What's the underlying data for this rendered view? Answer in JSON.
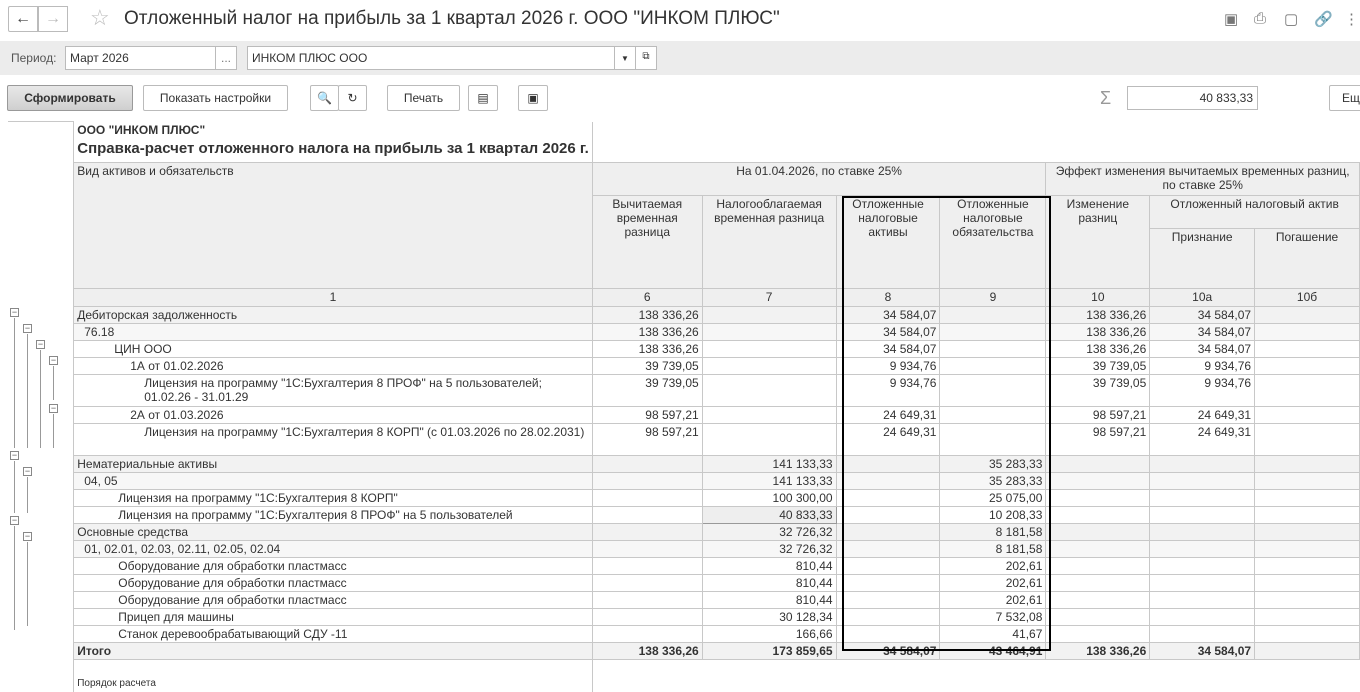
{
  "window": {
    "title": "Отложенный налог на прибыль за 1 квартал 2026 г. ООО \"ИНКОМ ПЛЮС\""
  },
  "filters": {
    "period_label": "Период:",
    "period_value": "Март 2026",
    "period_button": "...",
    "org_value": "ИНКОМ ПЛЮС ООО"
  },
  "toolbar": {
    "generate": "Сформировать",
    "show_settings": "Показать настройки",
    "print": "Печать",
    "sum_value": "40 833,33",
    "more": "Ещ"
  },
  "report": {
    "org": "ООО \"ИНКОМ ПЛЮС\"",
    "title": "Справка-расчет отложенного налога на прибыль за 1 квартал 2026 г.",
    "headers": {
      "col1": "Вид активов и обязательств",
      "group1": "На 01.04.2026, по ставке 25%",
      "group2": "Эффект изменения вычитаемых временных разниц, по ставке 25%",
      "c6": "Вычитаемая временная разница",
      "c7": "Налогооблагаемая временная разница",
      "c8": "Отложенные налоговые активы",
      "c9": "Отложенные налоговые обязательства",
      "c10": "Изменение разниц",
      "c10grp": "Отложенный налоговый актив",
      "c10a": "Признание",
      "c10b": "Погашение"
    },
    "numbers": [
      "1",
      "6",
      "7",
      "8",
      "9",
      "10",
      "10а",
      "10б"
    ],
    "rows": [
      {
        "name": "Дебиторская задолженность",
        "v": [
          "138 336,26",
          "",
          "34 584,07",
          "",
          "138 336,26",
          "34 584,07",
          ""
        ]
      },
      {
        "name": "76.18",
        "v": [
          "138 336,26",
          "",
          "34 584,07",
          "",
          "138 336,26",
          "34 584,07",
          ""
        ]
      },
      {
        "name": "ЦИН ООО",
        "v": [
          "138 336,26",
          "",
          "34 584,07",
          "",
          "138 336,26",
          "34 584,07",
          ""
        ]
      },
      {
        "name": "1А от 01.02.2026",
        "v": [
          "39 739,05",
          "",
          "9 934,76",
          "",
          "39 739,05",
          "9 934,76",
          ""
        ]
      },
      {
        "name": "Лицензия на программу \"1С:Бухгалтерия 8 ПРОФ\" на 5 пользователей; 01.02.26 - 31.01.29",
        "v": [
          "39 739,05",
          "",
          "9 934,76",
          "",
          "39 739,05",
          "9 934,76",
          ""
        ]
      },
      {
        "name": "2А от 01.03.2026",
        "v": [
          "98 597,21",
          "",
          "24 649,31",
          "",
          "98 597,21",
          "24 649,31",
          ""
        ]
      },
      {
        "name": "Лицензия на программу \"1С:Бухгалтерия 8 КОРП\" (с 01.03.2026 по 28.02.2031)",
        "v": [
          "98 597,21",
          "",
          "24 649,31",
          "",
          "98 597,21",
          "24 649,31",
          ""
        ]
      },
      {
        "name": "Нематериальные активы",
        "v": [
          "",
          "141 133,33",
          "",
          "35 283,33",
          "",
          "",
          ""
        ]
      },
      {
        "name": "04, 05",
        "v": [
          "",
          "141 133,33",
          "",
          "35 283,33",
          "",
          "",
          ""
        ]
      },
      {
        "name": "Лицензия на программу \"1С:Бухгалтерия 8 КОРП\"",
        "v": [
          "",
          "100 300,00",
          "",
          "25 075,00",
          "",
          "",
          ""
        ]
      },
      {
        "name": "Лицензия на программу \"1С:Бухгалтерия 8 ПРОФ\" на 5 пользователей",
        "v": [
          "",
          "40 833,33",
          "",
          "10 208,33",
          "",
          "",
          ""
        ]
      },
      {
        "name": "Основные средства",
        "v": [
          "",
          "32 726,32",
          "",
          "8 181,58",
          "",
          "",
          ""
        ]
      },
      {
        "name": "01, 02.01, 02.03, 02.11, 02.05, 02.04",
        "v": [
          "",
          "32 726,32",
          "",
          "8 181,58",
          "",
          "",
          ""
        ]
      },
      {
        "name": "Оборудование для обработки пластмасс",
        "v": [
          "",
          "810,44",
          "",
          "202,61",
          "",
          "",
          ""
        ]
      },
      {
        "name": "Оборудование для обработки пластмасс",
        "v": [
          "",
          "810,44",
          "",
          "202,61",
          "",
          "",
          ""
        ]
      },
      {
        "name": "Оборудование для обработки пластмасс",
        "v": [
          "",
          "810,44",
          "",
          "202,61",
          "",
          "",
          ""
        ]
      },
      {
        "name": "Прицеп для машины",
        "v": [
          "",
          "30 128,34",
          "",
          "7 532,08",
          "",
          "",
          ""
        ]
      },
      {
        "name": "Станок деревообрабатывающий СДУ -11",
        "v": [
          "",
          "166,66",
          "",
          "41,67",
          "",
          "",
          ""
        ]
      }
    ],
    "total": {
      "name": "Итого",
      "v": [
        "138 336,26",
        "173 859,65",
        "34 584,07",
        "43 464,91",
        "138 336,26",
        "34 584,07",
        ""
      ]
    },
    "footer": "Порядок расчета"
  }
}
